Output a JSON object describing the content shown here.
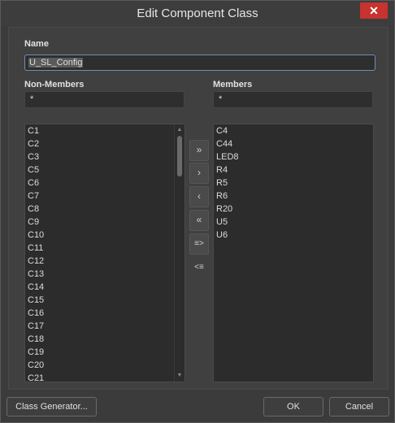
{
  "window": {
    "title": "Edit Component Class",
    "close_glyph": "✕"
  },
  "name_field": {
    "label": "Name",
    "value": "U_SL_Config"
  },
  "non_members": {
    "label": "Non-Members",
    "filter": "*",
    "items": [
      "C1",
      "C2",
      "C3",
      "C5",
      "C6",
      "C7",
      "C8",
      "C9",
      "C10",
      "C11",
      "C12",
      "C13",
      "C14",
      "C15",
      "C16",
      "C17",
      "C18",
      "C19",
      "C20",
      "C21"
    ]
  },
  "members": {
    "label": "Members",
    "filter": "*",
    "items": [
      "C4",
      "C44",
      "LED8",
      "R4",
      "R5",
      "R6",
      "R20",
      "U5",
      "U6"
    ]
  },
  "move_buttons": {
    "add_all": "»",
    "add": "›",
    "remove": "‹",
    "remove_all": "«",
    "add_selected": "≡>",
    "remove_selected": "<≡"
  },
  "footer": {
    "class_generator": "Class Generator...",
    "ok": "OK",
    "cancel": "Cancel"
  }
}
